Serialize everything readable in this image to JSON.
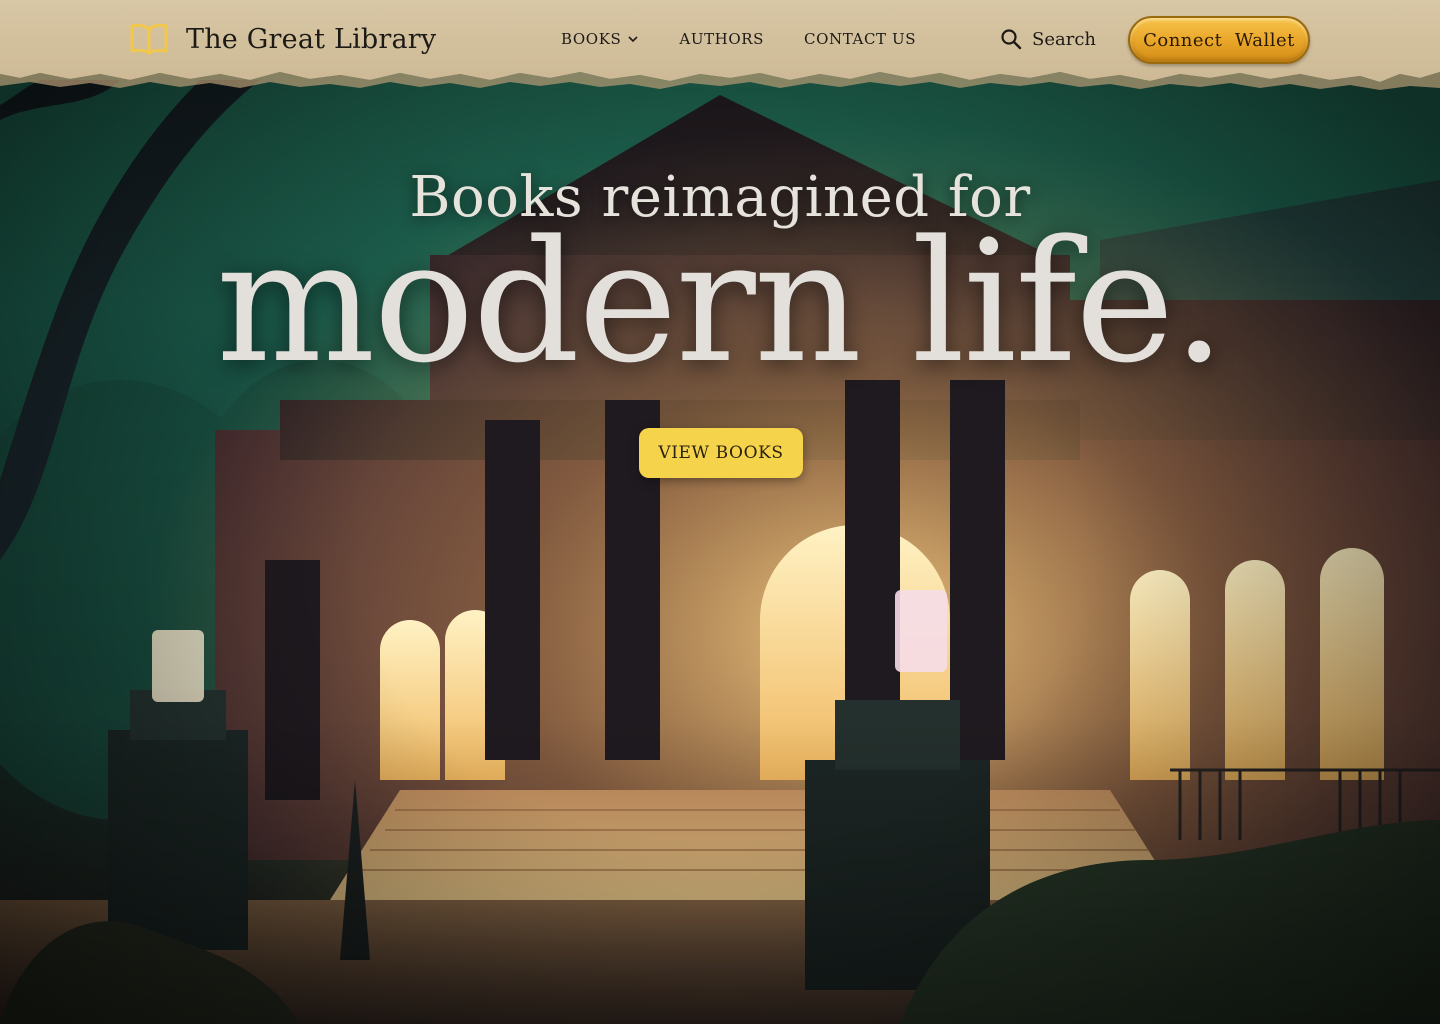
{
  "header": {
    "brand": "The Great Library",
    "logo_icon": "open-book-icon",
    "nav": [
      {
        "label": "BOOKS",
        "has_dropdown": true
      },
      {
        "label": "AUTHORS",
        "has_dropdown": false
      },
      {
        "label": "CONTACT US",
        "has_dropdown": false
      }
    ],
    "search_label": "Search",
    "connect_wallet_label": "Connect  Wallet"
  },
  "hero": {
    "tagline": "Books reimagined for",
    "headline": "modern life.",
    "cta_label": "VIEW BOOKS"
  },
  "colors": {
    "paper": "#d9c9a8",
    "accent_gold": "#f5d34a",
    "wallet_button": "#e8a528",
    "logo": "#f2c84b",
    "text_dark": "#1d1a16",
    "hero_text": "#e3dfda"
  }
}
